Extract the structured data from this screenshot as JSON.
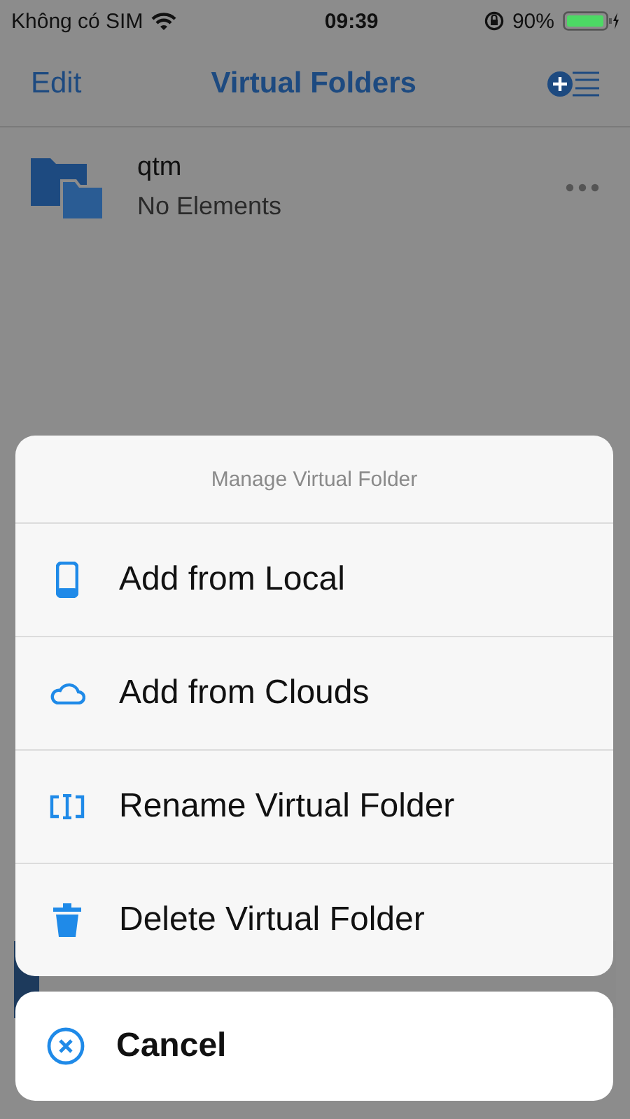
{
  "status_bar": {
    "carrier": "Không có SIM",
    "time": "09:39",
    "battery": "90%"
  },
  "nav_bar": {
    "left": "Edit",
    "title": "Virtual Folders"
  },
  "folders": [
    {
      "name": "qtm",
      "detail": "No Elements"
    }
  ],
  "action_sheet": {
    "title": "Manage Virtual Folder",
    "items": [
      {
        "kind": "phone",
        "label": "Add from Local"
      },
      {
        "kind": "cloud",
        "label": "Add from Clouds"
      },
      {
        "kind": "rename",
        "label": "Rename Virtual Folder"
      },
      {
        "kind": "trash",
        "label": "Delete Virtual Folder"
      }
    ],
    "cancel": "Cancel"
  }
}
